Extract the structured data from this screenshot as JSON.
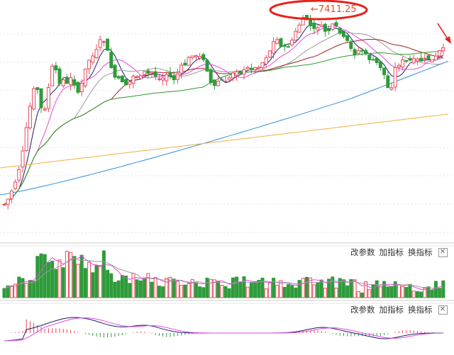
{
  "annotation": {
    "price_label": "←7411.25",
    "circle_color": "#e8201a",
    "arrow_color": "#e8201a"
  },
  "volume_panel": {
    "btn_edit_params": "改参数",
    "btn_add_indicator": "加指标",
    "btn_switch_indicator": "换指标",
    "close": "✕"
  },
  "macd_panel": {
    "btn_edit_params": "改参数",
    "btn_add_indicator": "加指标",
    "btn_switch_indicator": "换指标",
    "close": "✕"
  },
  "colors": {
    "up": "#e84a5a",
    "down": "#2e9b3a",
    "ma5": "#1b1b6b",
    "ma10": "#e04be0",
    "ma20": "#9a9a9a",
    "ma30": "#a02020",
    "ma60": "#2e9b2e",
    "ma120": "#2f8fdc",
    "ma250": "#f0b040"
  }
}
